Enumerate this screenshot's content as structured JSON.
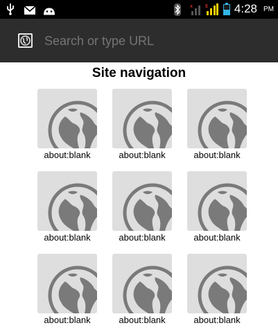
{
  "status_bar": {
    "time": "4:28",
    "ampm": "PM",
    "icons": [
      "usb-icon",
      "gmail-icon",
      "android-debug-icon",
      "bluetooth-icon",
      "signal-x-icon",
      "signal-e-icon",
      "battery-icon"
    ],
    "accent_color": "#ffd000"
  },
  "url_bar": {
    "placeholder": "Search or type URL",
    "favicon": "globe-icon"
  },
  "page": {
    "title": "Site navigation",
    "tiles": [
      {
        "label": "about:blank"
      },
      {
        "label": "about:blank"
      },
      {
        "label": "about:blank"
      },
      {
        "label": "about:blank"
      },
      {
        "label": "about:blank"
      },
      {
        "label": "about:blank"
      },
      {
        "label": "about:blank"
      },
      {
        "label": "about:blank"
      },
      {
        "label": "about:blank"
      }
    ]
  }
}
